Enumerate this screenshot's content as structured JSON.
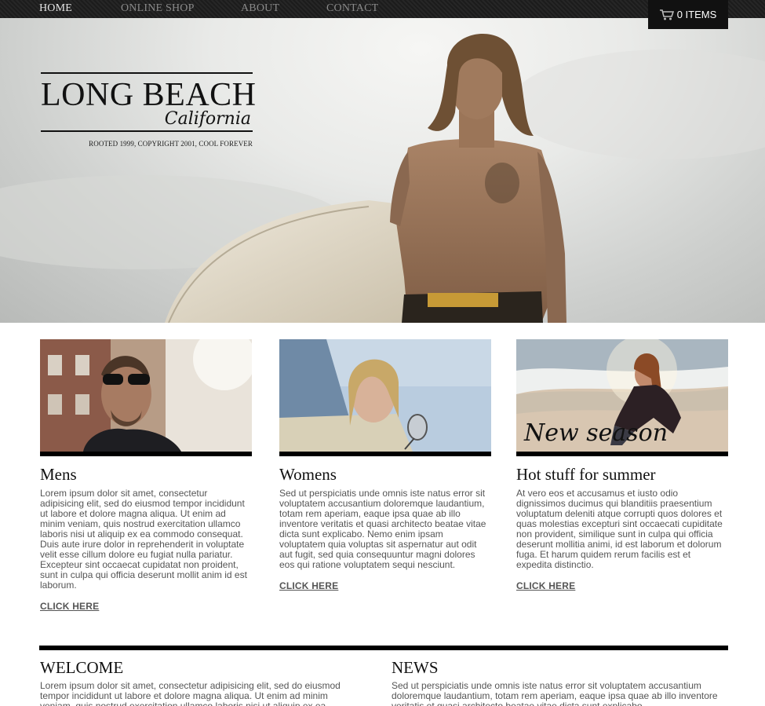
{
  "nav": {
    "items": [
      {
        "label": "HOME"
      },
      {
        "label": "ONLINE SHOP"
      },
      {
        "label": "ABOUT"
      },
      {
        "label": "CONTACT"
      }
    ]
  },
  "cart": {
    "label": "0 ITEMS",
    "icon": "cart-icon"
  },
  "brand": {
    "title": "LONG BEACH",
    "script": "California",
    "tagline": "ROOTED 1999, COPYRIGHT 2001, COOL FOREVER"
  },
  "features": [
    {
      "title": "Mens",
      "text": "Lorem ipsum dolor sit amet, consectetur adipisicing elit, sed do eiusmod tempor incididunt ut labore et dolore magna aliqua. Ut enim ad minim veniam, quis nostrud exercitation ullamco laboris nisi ut aliquip ex ea commodo consequat. Duis aute irure dolor in reprehenderit in voluptate velit esse cillum dolore eu fugiat nulla pariatur. Excepteur sint occaecat cupidatat non proident, sunt in culpa qui officia deserunt mollit anim id est laborum.",
      "link": "CLICK HERE"
    },
    {
      "title": "Womens",
      "text": "Sed ut perspiciatis unde omnis iste natus error sit voluptatem accusantium doloremque laudantium, totam rem aperiam, eaque ipsa quae ab illo inventore veritatis et quasi architecto beatae vitae dicta sunt explicabo. Nemo enim ipsam voluptatem quia voluptas sit aspernatur aut odit aut fugit, sed quia consequuntur magni dolores eos qui ratione voluptatem sequi nesciunt.",
      "link": "CLICK HERE"
    },
    {
      "title": "Hot stuff for summer",
      "overlay": "New season",
      "text": "At vero eos et accusamus et iusto odio dignissimos ducimus qui blanditiis praesentium voluptatum deleniti atque corrupti quos dolores et quas molestias excepturi sint occaecati cupiditate non provident, similique sunt in culpa qui officia deserunt mollitia animi, id est laborum et dolorum fuga. Et harum quidem rerum facilis est et expedita distinctio.",
      "link": "CLICK HERE"
    }
  ],
  "welcome": {
    "title": "WELCOME",
    "text": "Lorem ipsum dolor sit amet, consectetur adipisicing elit, sed do eiusmod tempor incididunt ut labore et dolore magna aliqua. Ut enim ad minim veniam, quis nostrud exercitation ullamco laboris nisi ut aliquip ex ea commodo consequat."
  },
  "news": {
    "title": "NEWS",
    "text": "Sed ut perspiciatis unde omnis iste natus error sit voluptatem accusantium doloremque laudantium, totam rem aperiam, eaque ipsa quae ab illo inventore veritatis et quasi architecto beatae vitae dicta sunt explicabo."
  }
}
